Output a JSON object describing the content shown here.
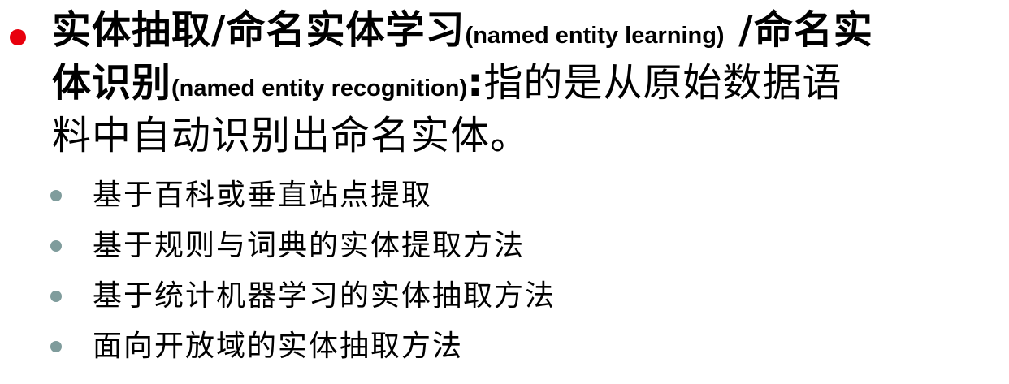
{
  "colors": {
    "main_bullet": "#e8000d",
    "sub_bullet": "#7f9c9c",
    "text": "#000000"
  },
  "main_point": {
    "term_cn_1": "实体抽取/命名实体学习",
    "term_en_1": "(named entity learning)",
    "slash": " /",
    "term_cn_2a": "命名实",
    "term_cn_2b": "体识别",
    "term_en_2": "(named entity recognition)",
    "colon": ":",
    "definition_a": "指的是从原始数据语",
    "definition_b": "料中自动识别出命名实体。"
  },
  "sub_points": [
    "基于百科或垂直站点提取",
    "基于规则与词典的实体提取方法",
    "基于统计机器学习的实体抽取方法",
    "面向开放域的实体抽取方法"
  ]
}
